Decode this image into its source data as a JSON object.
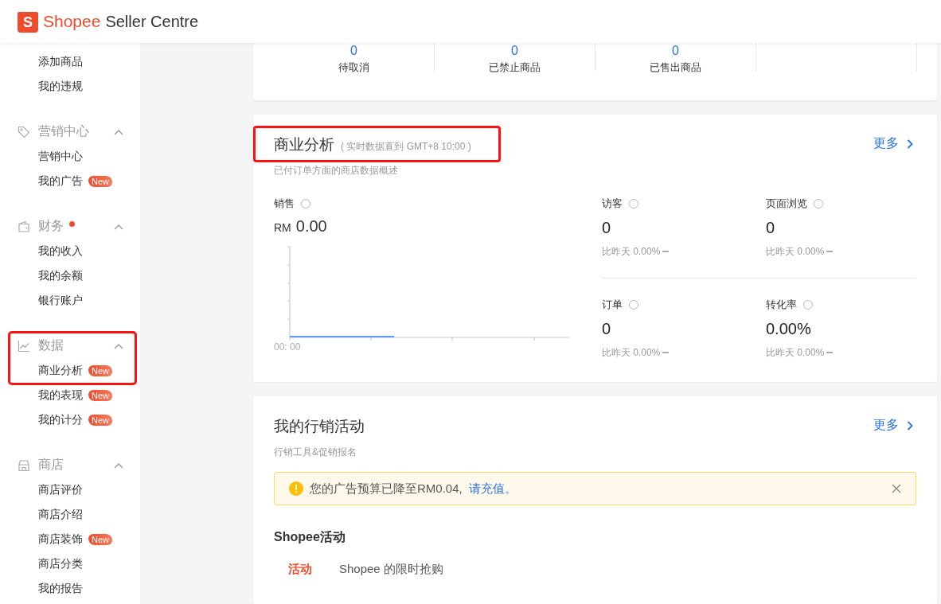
{
  "header": {
    "logo_mark": "S",
    "brand": "Shopee",
    "product": "Seller Centre"
  },
  "sidebar": {
    "groups": [
      {
        "items": [
          {
            "label": "添加商品"
          },
          {
            "label": "我的违规"
          }
        ]
      },
      {
        "title": "营销中心",
        "expanded": true,
        "items": [
          {
            "label": "营销中心"
          },
          {
            "label": "我的广告",
            "badge": "New"
          }
        ]
      },
      {
        "title": "财务",
        "expanded": true,
        "alert_dot": true,
        "items": [
          {
            "label": "我的收入"
          },
          {
            "label": "我的余额"
          },
          {
            "label": "银行账户"
          }
        ]
      },
      {
        "title": "数据",
        "expanded": true,
        "highlighted": true,
        "items": [
          {
            "label": "商业分析",
            "badge": "New"
          },
          {
            "label": "我的表现",
            "badge": "New"
          },
          {
            "label": "我的计分",
            "badge": "New"
          }
        ]
      },
      {
        "title": "商店",
        "expanded": true,
        "items": [
          {
            "label": "商店评价"
          },
          {
            "label": "商店介绍"
          },
          {
            "label": "商店装饰",
            "badge": "New"
          },
          {
            "label": "商店分类"
          },
          {
            "label": "我的报告"
          }
        ]
      }
    ]
  },
  "todo": [
    {
      "value": "0",
      "label": "待取消"
    },
    {
      "value": "0",
      "label": "已禁止商品"
    },
    {
      "value": "0",
      "label": "已售出商品"
    }
  ],
  "analytics": {
    "title": "商业分析",
    "title_note": "( 实时数据直到 GMT+8 10:00 )",
    "title_highlighted": true,
    "more": "更多",
    "subtitle": "已付订单方面的商店数据概述",
    "sales": {
      "label": "销售",
      "currency": "RM",
      "value": "0.00",
      "x_label": "00: 00"
    },
    "metrics": [
      {
        "label": "访客",
        "value": "0",
        "compare": "比昨天 0.00%"
      },
      {
        "label": "页面浏览",
        "value": "0",
        "compare": "比昨天 0.00%"
      },
      {
        "label": "订单",
        "value": "0",
        "compare": "比昨天 0.00%"
      },
      {
        "label": "转化率",
        "value": "0.00%",
        "compare": "比昨天 0.00%"
      }
    ]
  },
  "marketing": {
    "title": "我的行销活动",
    "more": "更多",
    "subtitle": "行销工具&促销报名",
    "alert": {
      "text": "您的广告预算已降至RM0.04,",
      "link": "请充值。"
    },
    "section_title": "Shopee活动",
    "tabs": [
      {
        "label": "活动",
        "selected": true
      },
      {
        "label": "Shopee 的限时抢购",
        "selected": false
      }
    ]
  }
}
